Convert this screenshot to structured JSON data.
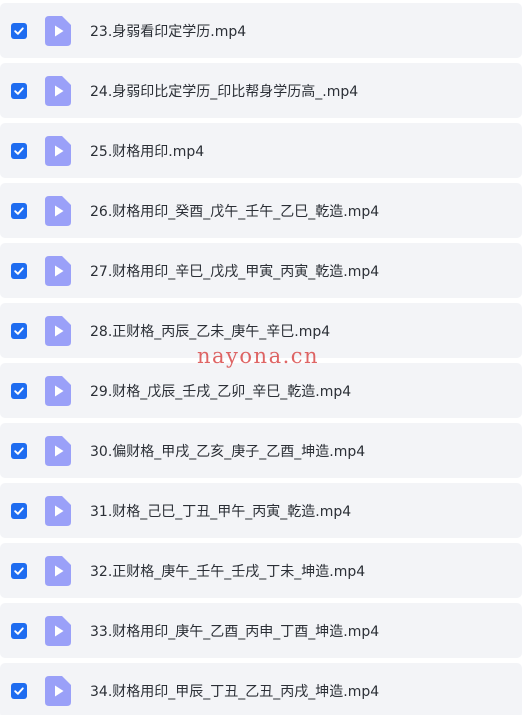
{
  "colors": {
    "row_background": "#f3f4f7",
    "checkbox": "#1e6cf0",
    "file_icon": "#9aa0f8",
    "watermark": "#d63a3a"
  },
  "file_icon_name": "video-file-icon",
  "checkbox_icon_name": "checkmark-icon",
  "files": [
    {
      "name": "23.身弱看印定学历.mp4",
      "checked": true
    },
    {
      "name": "24.身弱印比定学历_印比帮身学历高_.mp4",
      "checked": true
    },
    {
      "name": "25.财格用印.mp4",
      "checked": true
    },
    {
      "name": "26.财格用印_癸酉_戊午_壬午_乙巳_乾造.mp4",
      "checked": true
    },
    {
      "name": "27.财格用印_辛巳_戊戌_甲寅_丙寅_乾造.mp4",
      "checked": true
    },
    {
      "name": "28.正财格_丙辰_乙未_庚午_辛巳.mp4",
      "checked": true
    },
    {
      "name": "29.财格_戊辰_壬戌_乙卯_辛巳_乾造.mp4",
      "checked": true
    },
    {
      "name": "30.偏财格_甲戌_乙亥_庚子_乙酉_坤造.mp4",
      "checked": true
    },
    {
      "name": "31.财格_己巳_丁丑_甲午_丙寅_乾造.mp4",
      "checked": true
    },
    {
      "name": "32.正财格_庚午_壬午_壬戌_丁未_坤造.mp4",
      "checked": true
    },
    {
      "name": "33.财格用印_庚午_乙酉_丙申_丁酉_坤造.mp4",
      "checked": true
    },
    {
      "name": "34.财格用印_甲辰_丁丑_乙丑_丙戌_坤造.mp4",
      "checked": true
    }
  ],
  "watermark": "nayona.cn"
}
